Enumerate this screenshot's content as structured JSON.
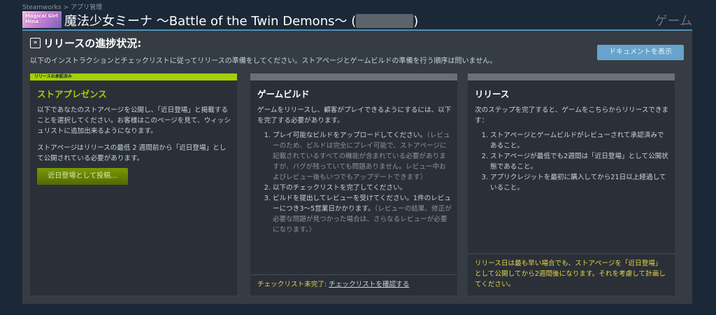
{
  "breadcrumb": {
    "root": "Steamworks",
    "separator": ">",
    "current": "アプリ管理"
  },
  "app": {
    "title_prefix": "魔法少女ミーナ 〜Battle of the Twin Demons〜 (",
    "title_suffix": ")",
    "section": "ゲーム",
    "thumb_text": "Magical Girl Mina"
  },
  "panel": {
    "title": "リリースの進捗状況:",
    "description": "以下のインストラクションとチェックリストに従ってリリースの準備をしてください。ストアページとゲームビルドの準備を行う順序は問いません。",
    "doc_button": "ドキュメントを表示"
  },
  "cards": {
    "store": {
      "badge": "リリースの承認済み",
      "title": "ストアプレゼンス",
      "p1": "以下であなたのストアページを公開し、「近日登場」と掲載することを選択してください。お客様はこのページを見て、ウィッシュリストに追加出来るようになります。",
      "p2": "ストアページはリリースの最低 2 週間前から「近日登場」として公開されている必要があります。",
      "button": "近日登場として投稿..."
    },
    "build": {
      "title": "ゲームビルド",
      "intro": "ゲームをリリースし、顧客がプレイできるようにするには、以下を完了する必要があります。",
      "step1": "プレイ可能なビルドをアップロードしてください。",
      "step1_note": "（レビューのため、ビルドは完全にプレイ可能で、ストアページに記載されているすべての機能が含まれている必要がありますが、バグが残っていても問題ありません。レビュー中およびレビュー後もいつでもアップデートできます）",
      "step2": "以下のチェックリストを完了してください。",
      "step3": "ビルドを提出してレビューを受けてください。1件のレビューにつき3〜5営業日かかります。",
      "step3_note": "（レビューの結果、修正が必要な問題が見つかった場合は、さらなるレビューが必要になります。）",
      "foot_label": "チェックリスト未完了:",
      "foot_link": "チェックリストを確認する"
    },
    "release": {
      "title": "リリース",
      "intro": "次のステップを完了すると、ゲームをこちらからリリースできます：",
      "step1": "ストアページとゲームビルドがレビューされて承認済みであること。",
      "step2": "ストアページが最低でも2週間は「近日登場」として公開状態であること。",
      "step3": "アプリクレジットを最初に購入してから21日以上経過していること。",
      "foot": "リリース日は最も早い場合でも、ストアページを「近日登場」として公開してから2週間後になります。それを考慮して計画してください。"
    }
  },
  "colors": {
    "background": "#1b2838",
    "panel": "#363c44",
    "card": "#2b3038",
    "approved": "#a4d007",
    "link_blue": "#67a3cb",
    "warning": "#e4d544"
  }
}
